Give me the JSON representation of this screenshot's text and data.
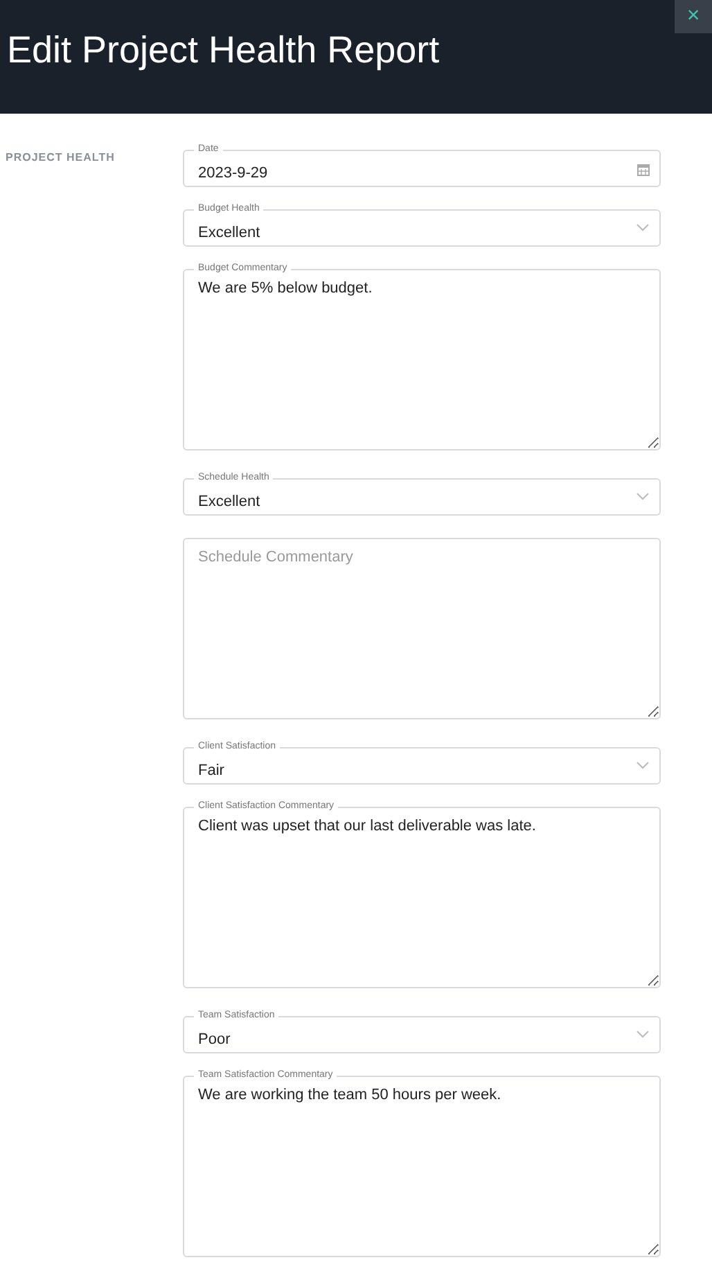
{
  "header": {
    "title": "Edit Project Health Report",
    "close": "×"
  },
  "section": {
    "label": "PROJECT HEALTH"
  },
  "fields": [
    {
      "kind": "date",
      "label": "Date",
      "value": "2023-9-29"
    },
    {
      "kind": "select",
      "label": "Budget Health",
      "value": "Excellent"
    },
    {
      "kind": "textarea",
      "label": "Budget Commentary",
      "value": "We are 5% below budget."
    },
    {
      "kind": "select",
      "label": "Schedule Health",
      "value": "Excellent"
    },
    {
      "kind": "textarea",
      "placeholder": "Schedule Commentary"
    },
    {
      "kind": "select",
      "label": "Client Satisfaction",
      "value": "Fair"
    },
    {
      "kind": "textarea",
      "label": "Client Satisfaction Commentary",
      "value": "Client was upset that our last deliverable was late."
    },
    {
      "kind": "select",
      "label": "Team Satisfaction",
      "value": "Poor"
    },
    {
      "kind": "textarea",
      "label": "Team Satisfaction Commentary",
      "value": "We are working the team 50 hours per week."
    }
  ]
}
